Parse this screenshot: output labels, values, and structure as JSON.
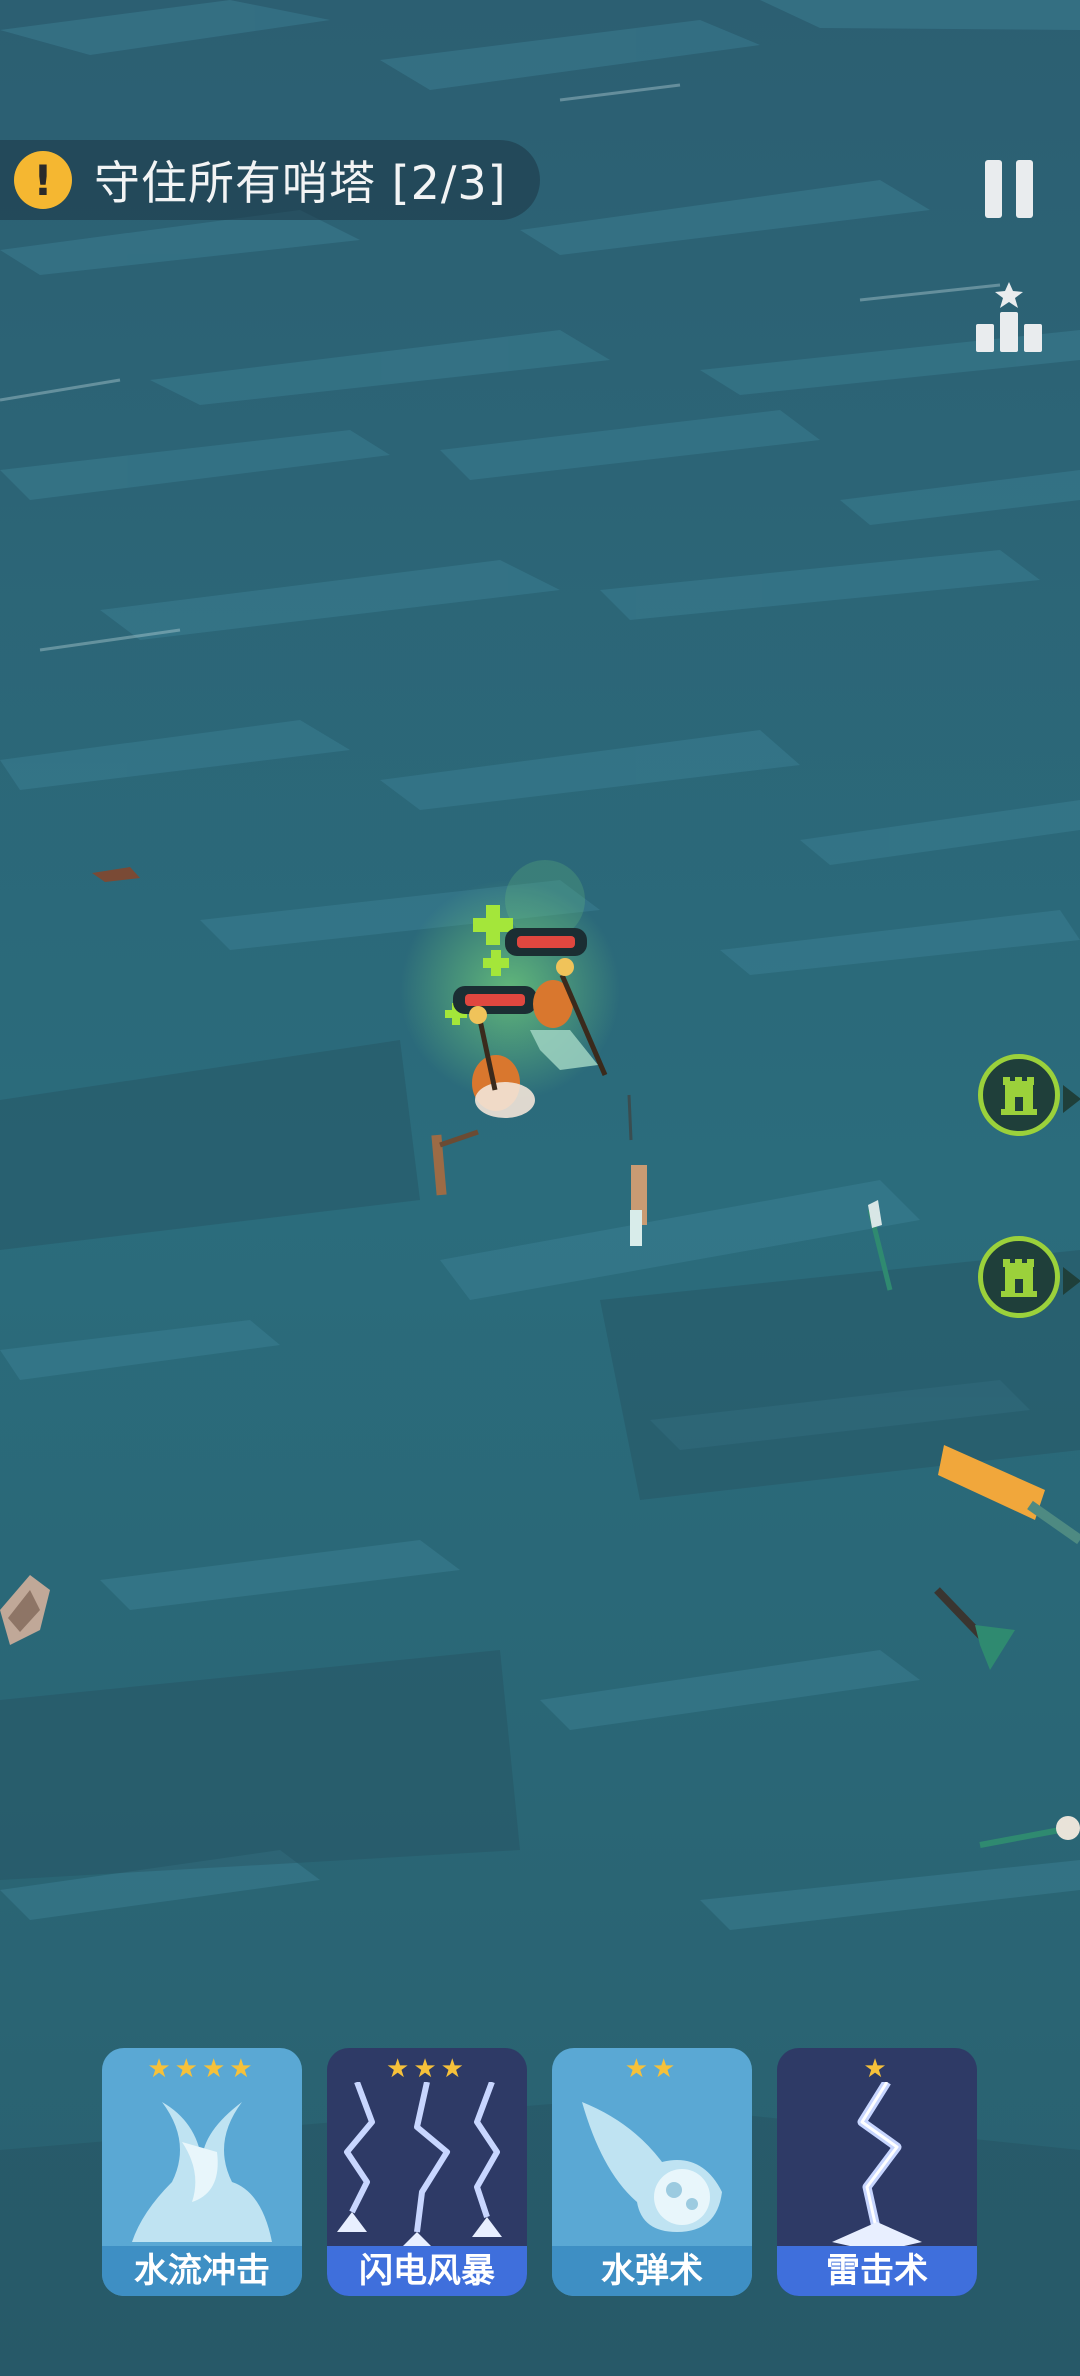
{
  "objective": {
    "icon": "exclamation-icon",
    "icon_glyph": "!",
    "text": "守住所有哨塔 [2/3]"
  },
  "buttons": {
    "pause": "pause-icon",
    "ranking": "ranking-podium-icon"
  },
  "tower_markers": [
    {
      "icon": "tower-icon"
    },
    {
      "icon": "tower-icon"
    }
  ],
  "skills": [
    {
      "name": "水流冲击",
      "stars": "★★★★",
      "level": 4,
      "theme": "water",
      "bg": "#5aa8d4",
      "label_bg": "#3e8fc4"
    },
    {
      "name": "闪电风暴",
      "stars": "★★★",
      "level": 3,
      "theme": "lightning",
      "bg": "#2e3a66",
      "label_bg": "#3f6fdc"
    },
    {
      "name": "水弹术",
      "stars": "★★",
      "level": 2,
      "theme": "water",
      "bg": "#5aa8d4",
      "label_bg": "#3e8fc4"
    },
    {
      "name": "雷击术",
      "stars": "★",
      "level": 1,
      "theme": "lightning",
      "bg": "#2e3a66",
      "label_bg": "#3f6fdc"
    }
  ],
  "colors": {
    "sea": "#2b6a7a",
    "hp_bar": "#e0473f",
    "heal": "#a4e63a",
    "tower_ring": "#9bd13b"
  }
}
